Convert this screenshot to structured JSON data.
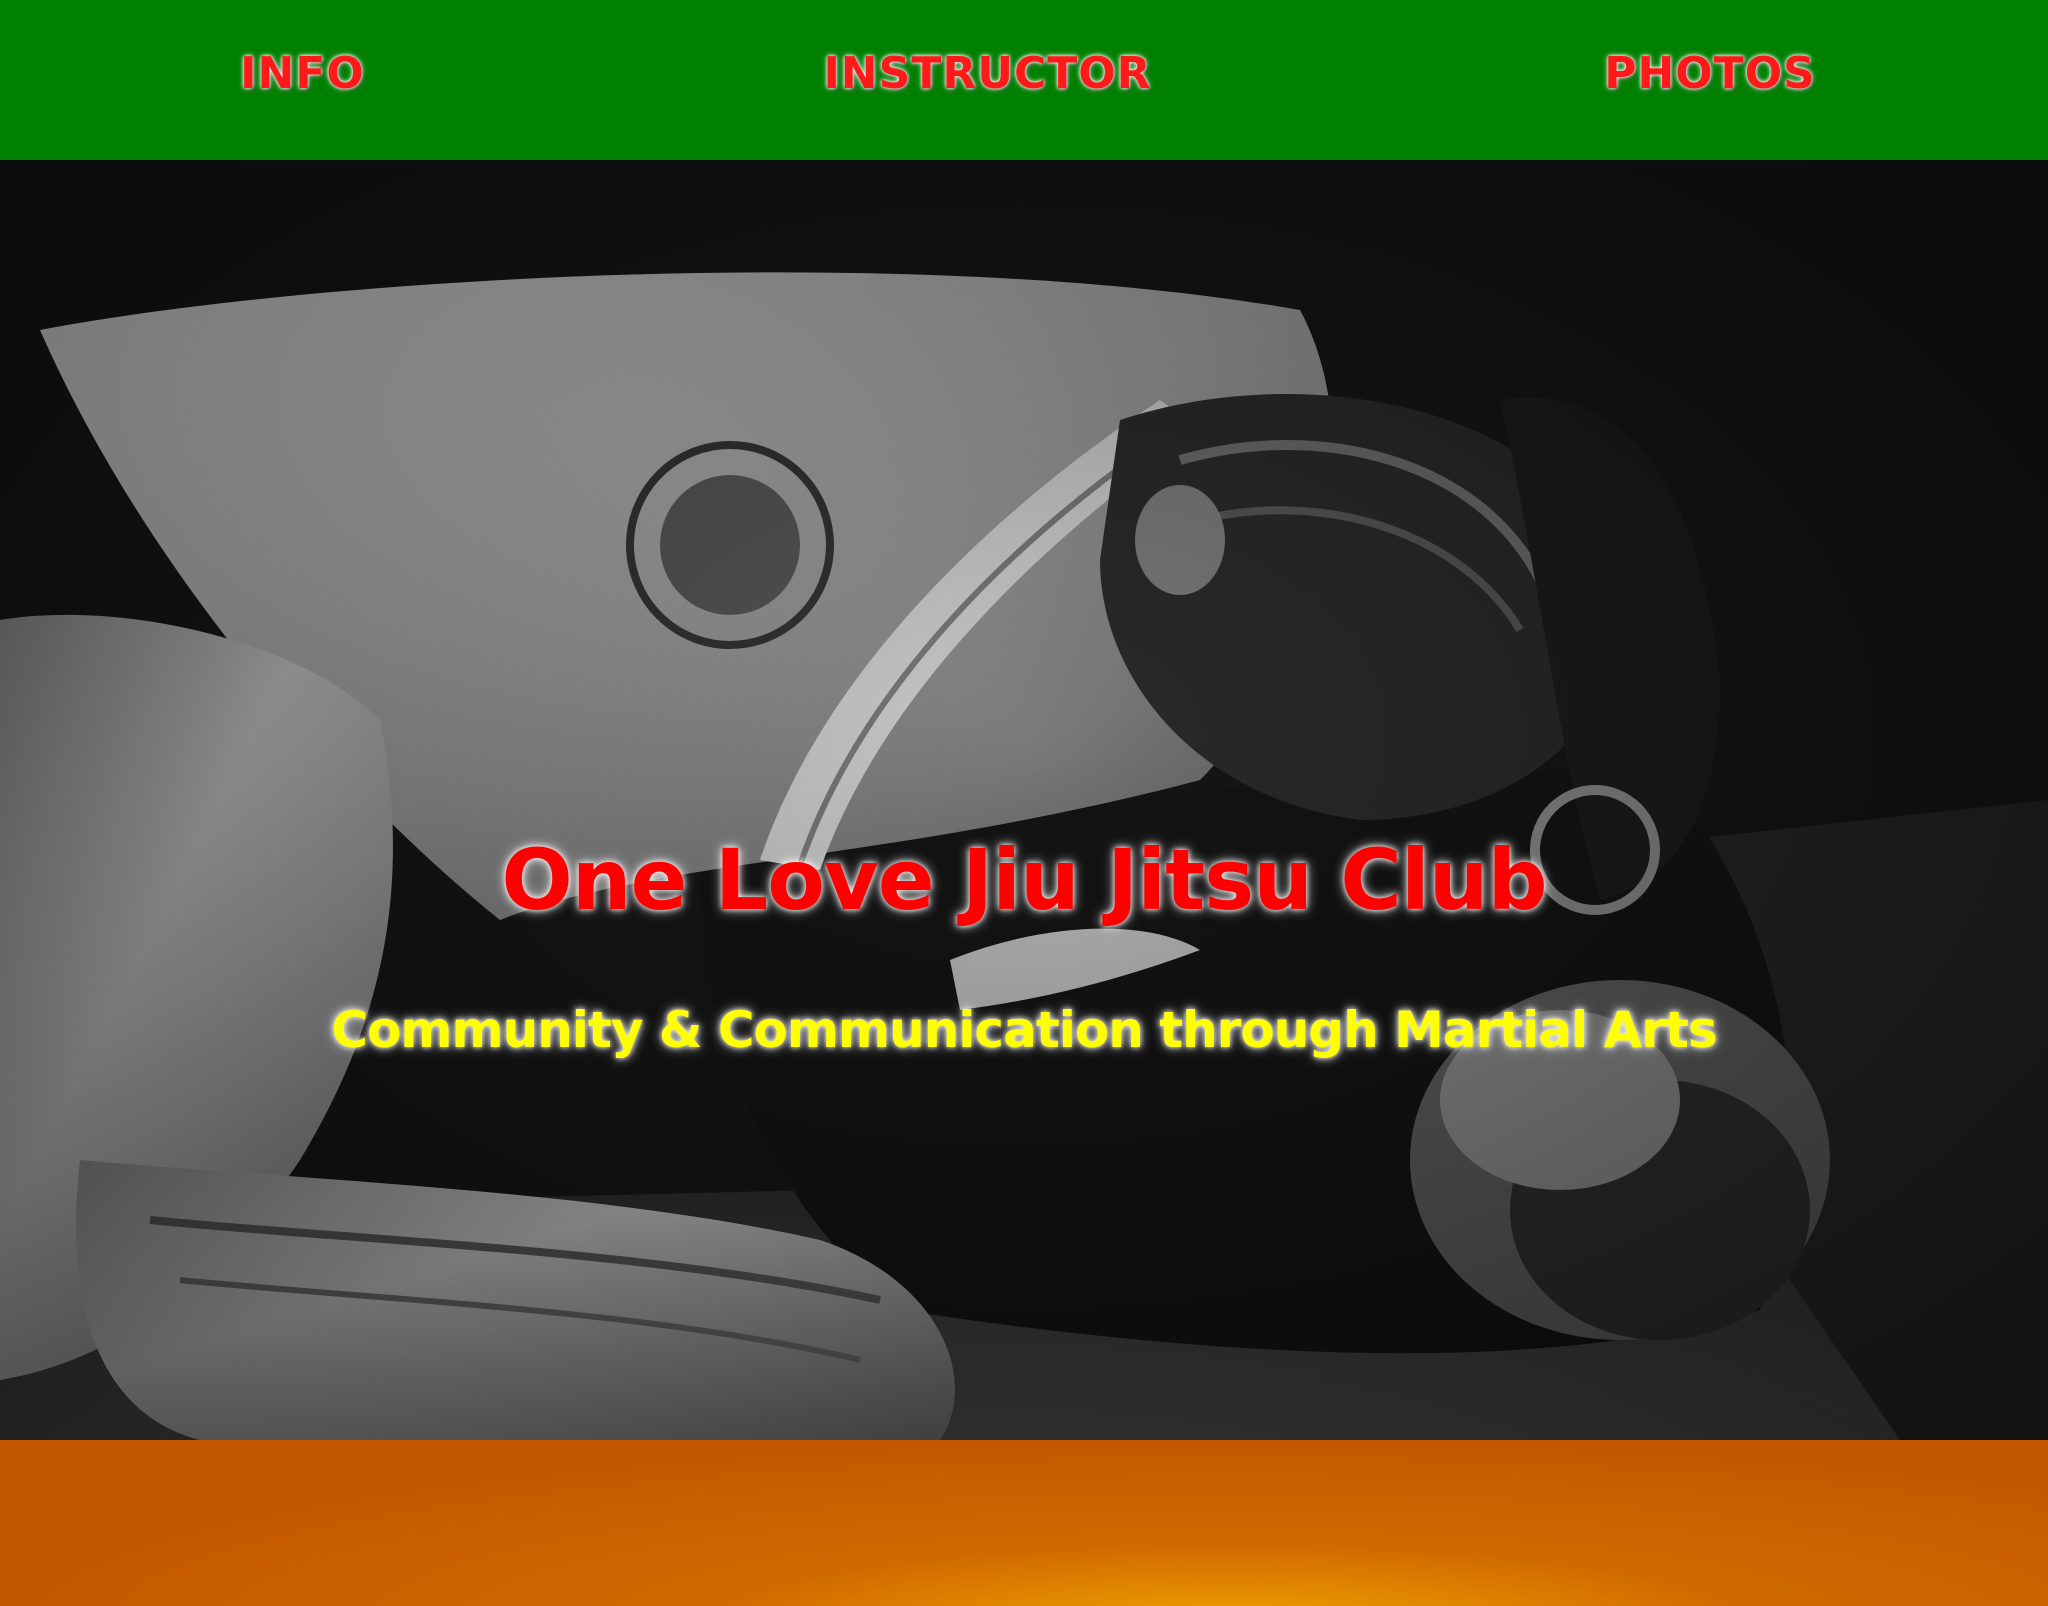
{
  "nav": {
    "items": [
      {
        "label": "INFO"
      },
      {
        "label": "INSTRUCTOR"
      },
      {
        "label": "PHOTOS"
      }
    ],
    "background_color": "#008000",
    "text_color": "#ff1a1a"
  },
  "hero": {
    "image_description_icon": "grappling-photo",
    "title": "One Love Jiu Jitsu Club",
    "subtitle": "Community & Communication through Martial Arts",
    "title_color": "#ff0000",
    "subtitle_color": "#ffff00"
  },
  "footer_band": {
    "color": "#c85a00"
  }
}
